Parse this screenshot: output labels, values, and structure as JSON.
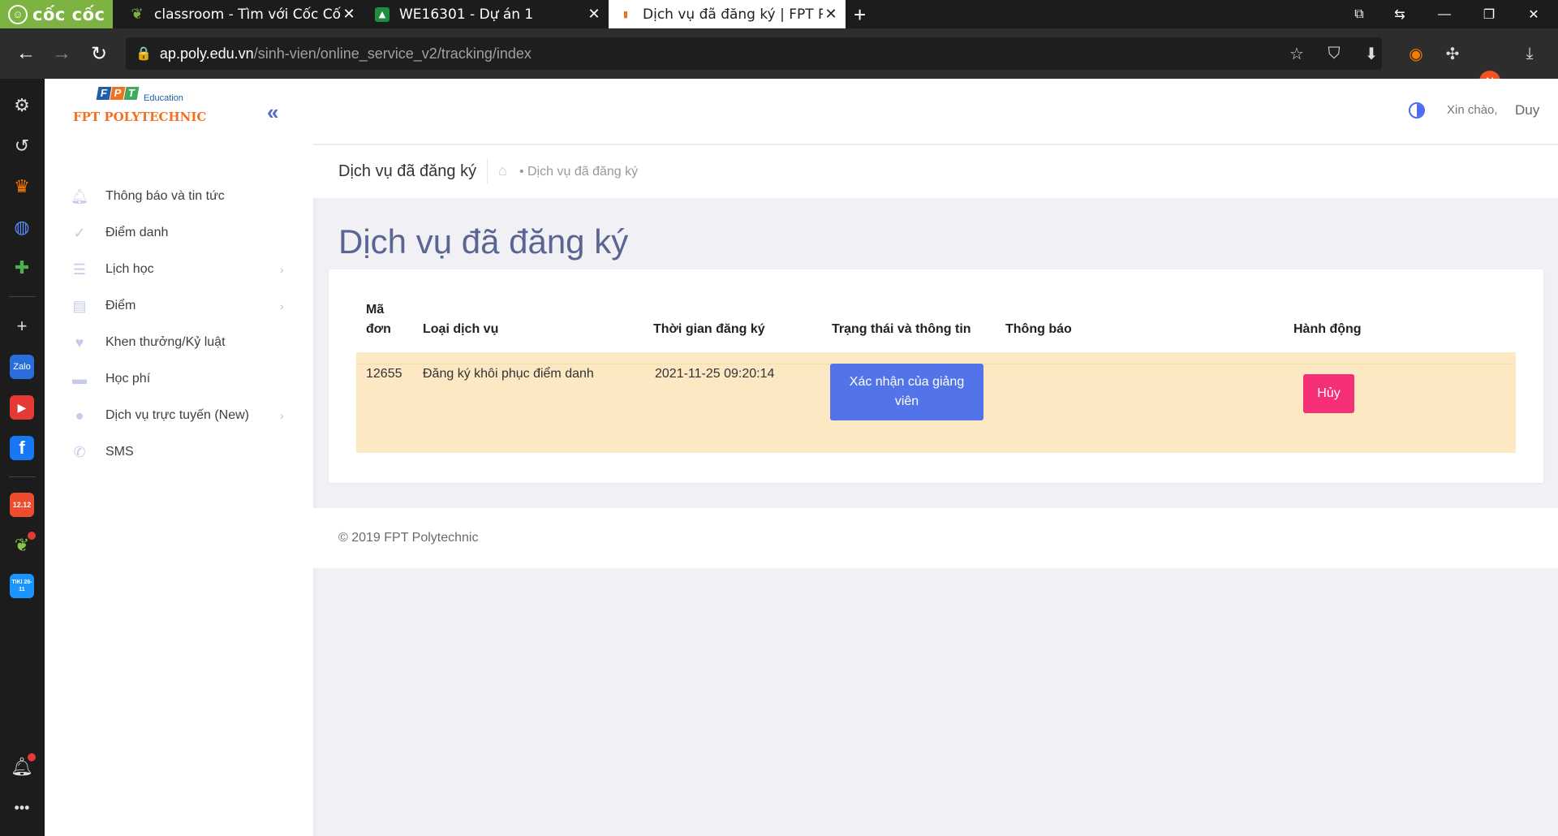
{
  "browser": {
    "brand": "cốc cốc",
    "tabs": [
      {
        "title": "classroom - Tìm với Cốc Cốc",
        "favicon": "coccoc-leaf-icon"
      },
      {
        "title": "WE16301 - Dự án 1",
        "favicon": "google-classroom-icon"
      },
      {
        "title": "Dịch vụ đã đăng ký | FPT Poly",
        "favicon": "fpt-icon"
      }
    ],
    "url_host": "ap.poly.edu.vn",
    "url_path": "/sinh-vien/online_service_v2/tracking/index",
    "profile_initial": "N",
    "sidebar_badges": {
      "shopee": "12.12",
      "tiki": "TIKI 26-11"
    },
    "accent": "#7cb342"
  },
  "app": {
    "logo": {
      "fpt": "FPT",
      "education": "Education",
      "name": "FPT POLYTECHNIC"
    },
    "menu": [
      {
        "label": "Thông báo và tin tức",
        "icon": "bell-icon"
      },
      {
        "label": "Điểm danh",
        "icon": "check-icon"
      },
      {
        "label": "Lịch học",
        "icon": "list-icon",
        "arrow": "›"
      },
      {
        "label": "Điểm",
        "icon": "book-icon",
        "arrow": "›"
      },
      {
        "label": "Khen thưởng/Kỷ luật",
        "icon": "heart-icon"
      },
      {
        "label": "Học phí",
        "icon": "wallet-icon"
      },
      {
        "label": "Dịch vụ trực tuyến (New)",
        "icon": "globe-icon",
        "arrow": "›"
      },
      {
        "label": "SMS",
        "icon": "phone-icon"
      }
    ],
    "header": {
      "greeting": "Xin chào,",
      "username": "Duy"
    },
    "titlebar": {
      "title": "Dịch vụ đã đăng ký",
      "breadcrumb": "Dịch vụ đã đăng ký"
    },
    "page_title": "Dịch vụ đã đăng ký",
    "table": {
      "columns": [
        "Mã đơn",
        "Loại dịch vụ",
        "Thời gian đăng ký",
        "Trạng thái và thông tin",
        "Thông báo",
        "Hành động"
      ],
      "rows": [
        {
          "code": "12655",
          "service": "Đăng ký khôi phục điểm danh",
          "time": "2021-11-25 09:20:14",
          "status": "Xác nhận của giảng viên",
          "notice": "",
          "action": "Hủy"
        }
      ]
    },
    "footer": "© 2019 FPT Polytechnic",
    "colors": {
      "primary": "#5374e8",
      "danger": "#f52f76",
      "row_highlight": "#fce8c3",
      "heading": "#5a6592"
    }
  }
}
